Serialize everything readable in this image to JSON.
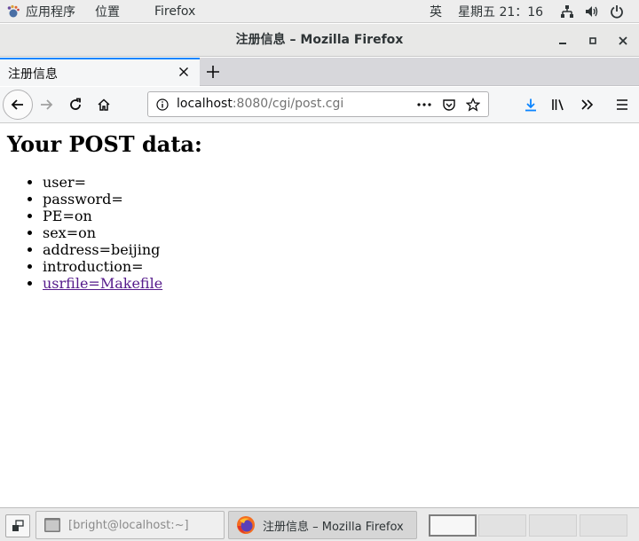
{
  "topbar": {
    "apps_label": "应用程序",
    "places_label": "位置",
    "app_name": "Firefox",
    "input_method": "英",
    "clock": "星期五 21：16"
  },
  "window": {
    "title": "注册信息 – Mozilla Firefox"
  },
  "tabs": [
    {
      "label": "注册信息",
      "active": true
    }
  ],
  "urlbar": {
    "host": "localhost",
    "rest": ":8080/cgi/post.cgi"
  },
  "page": {
    "heading": "Your POST data:",
    "items": [
      "user=",
      "password=",
      "PE=on",
      "sex=on",
      "address=beijing",
      "introduction="
    ],
    "link_item": "usrfile=Makefile"
  },
  "taskbar": {
    "tasks": [
      {
        "label": "[bright@localhost:~]",
        "icon": "terminal-icon"
      },
      {
        "label": "注册信息 – Mozilla Firefox",
        "icon": "firefox-icon"
      }
    ],
    "workspaces": 4,
    "active_workspace": 1
  },
  "colors": {
    "accent": "#0a84ff",
    "link_visited": "#551a8b",
    "download_icon": "#0a84ff"
  }
}
